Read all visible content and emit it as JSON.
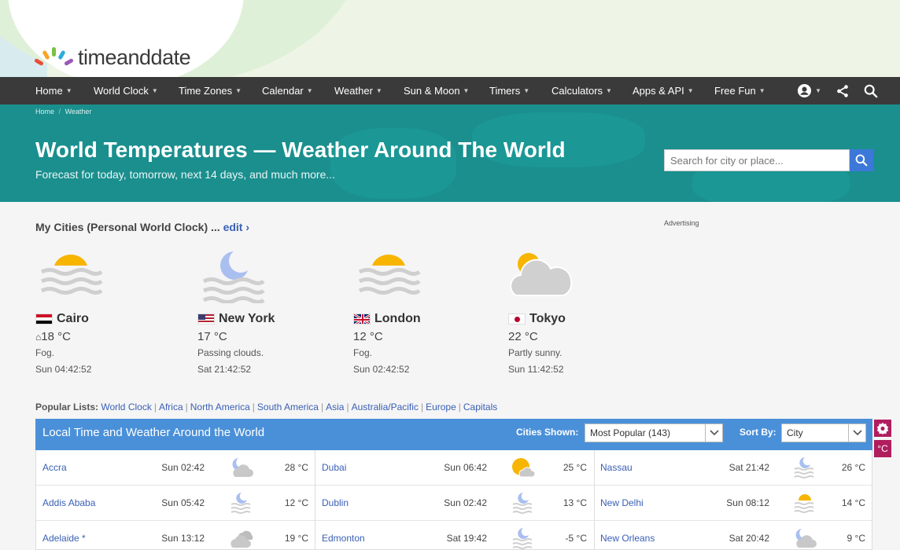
{
  "logo": {
    "text": "timeanddate"
  },
  "nav": {
    "items": [
      "Home",
      "World Clock",
      "Time Zones",
      "Calendar",
      "Weather",
      "Sun & Moon",
      "Timers",
      "Calculators",
      "Apps & API",
      "Free Fun"
    ]
  },
  "breadcrumb": {
    "home": "Home",
    "current": "Weather"
  },
  "hero": {
    "title": "World Temperatures — Weather Around The World",
    "subtitle": "Forecast for today, tomorrow, next 14 days, and much more...",
    "search_placeholder": "Search for city or place..."
  },
  "my_cities": {
    "heading": "My Cities (Personal World Clock) ...",
    "edit": "edit ›",
    "advertising": "Advertising",
    "cities": [
      {
        "name": "Cairo",
        "temp": "18 °C",
        "home_marker": "⌂",
        "desc": "Fog.",
        "time": "Sun 04:42:52",
        "icon": "fog-sun-icon"
      },
      {
        "name": "New York",
        "temp": "17 °C",
        "home_marker": "",
        "desc": "Passing clouds.",
        "time": "Sat 21:42:52",
        "icon": "fog-moon-icon"
      },
      {
        "name": "London",
        "temp": "12 °C",
        "home_marker": "",
        "desc": "Fog.",
        "time": "Sun 02:42:52",
        "icon": "fog-sun-icon"
      },
      {
        "name": "Tokyo",
        "temp": "22 °C",
        "home_marker": "",
        "desc": "Partly sunny.",
        "time": "Sun 11:42:52",
        "icon": "partly-sunny-icon"
      }
    ]
  },
  "popular": {
    "label": "Popular Lists:",
    "links": [
      "World Clock",
      "Africa",
      "North America",
      "South America",
      "Asia",
      "Australia/Pacific",
      "Europe",
      "Capitals"
    ]
  },
  "table": {
    "title": "Local Time and Weather Around the World",
    "cities_shown_label": "Cities Shown:",
    "cities_shown_value": "Most Popular (143)",
    "sort_label": "Sort By:",
    "sort_value": "City",
    "unit_toggle": "°C",
    "columns": [
      [
        {
          "city": "Accra",
          "time": "Sun 02:42",
          "temp": "28 °C",
          "icon": "cloudy-moon-icon"
        },
        {
          "city": "Addis Ababa",
          "time": "Sun 05:42",
          "temp": "12 °C",
          "icon": "fog-moon-icon"
        },
        {
          "city": "Adelaide *",
          "time": "Sun 13:12",
          "temp": "19 °C",
          "icon": "cloudy-icon"
        }
      ],
      [
        {
          "city": "Dubai",
          "time": "Sun 06:42",
          "temp": "25 °C",
          "icon": "partly-sunny-icon"
        },
        {
          "city": "Dublin",
          "time": "Sun 02:42",
          "temp": "13 °C",
          "icon": "fog-moon-icon"
        },
        {
          "city": "Edmonton",
          "time": "Sat 19:42",
          "temp": "-5 °C",
          "icon": "fog-moon-icon"
        }
      ],
      [
        {
          "city": "Nassau",
          "time": "Sat 21:42",
          "temp": "26 °C",
          "icon": "fog-moon-icon"
        },
        {
          "city": "New Delhi",
          "time": "Sun 08:12",
          "temp": "14 °C",
          "icon": "fog-sun-icon"
        },
        {
          "city": "New Orleans",
          "time": "Sat 20:42",
          "temp": "9 °C",
          "icon": "cloudy-moon-icon"
        }
      ]
    ]
  },
  "colors": {
    "nav_bg": "#3a3a3a",
    "hero_bg": "#1a8f8e",
    "link": "#3a60b4",
    "table_head": "#4a90d9",
    "accent": "#b01e5e"
  }
}
